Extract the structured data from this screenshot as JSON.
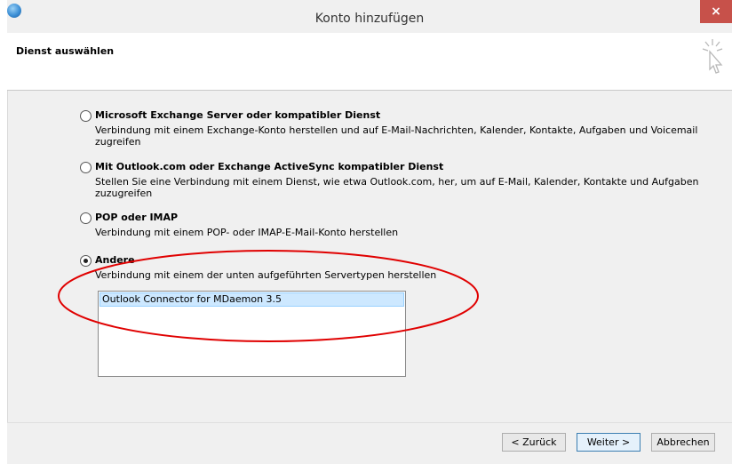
{
  "window": {
    "title": "Konto hinzufügen",
    "close_label": "×"
  },
  "header": {
    "title": "Dienst auswählen"
  },
  "options": [
    {
      "label": "Microsoft Exchange Server oder kompatibler Dienst",
      "description": "Verbindung mit einem Exchange-Konto herstellen und auf E-Mail-Nachrichten, Kalender, Kontakte, Aufgaben und Voicemail zugreifen",
      "selected": false
    },
    {
      "label": "Mit Outlook.com oder Exchange ActiveSync kompatibler Dienst",
      "description": "Stellen Sie eine Verbindung mit einem Dienst, wie etwa Outlook.com, her, um auf E-Mail, Kalender, Kontakte und Aufgaben zuzugreifen",
      "selected": false
    },
    {
      "label": "POP oder IMAP",
      "description": "Verbindung mit einem POP- oder IMAP-E-Mail-Konto herstellen",
      "selected": false
    },
    {
      "label": "Andere",
      "description": "Verbindung mit einem der unten aufgeführten Servertypen herstellen",
      "selected": true
    }
  ],
  "server_types": {
    "items": [
      "Outlook Connector for MDaemon 3.5"
    ],
    "selected": "Outlook Connector for MDaemon 3.5"
  },
  "footer": {
    "back_label": "< Zurück",
    "next_label": "Weiter >",
    "cancel_label": "Abbrechen"
  },
  "colors": {
    "close_button": "#c7514a",
    "annotation": "#e00000",
    "selection": "#cde8ff"
  },
  "icons": {
    "app": "outlook-app-icon",
    "wizard": "cursor-click-icon"
  }
}
